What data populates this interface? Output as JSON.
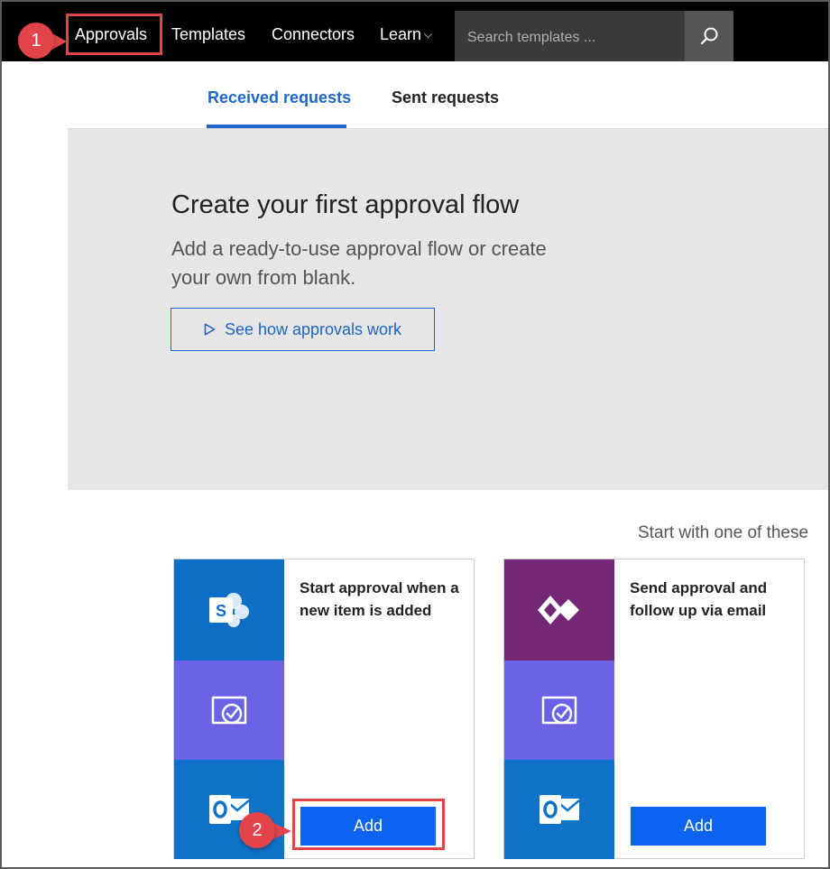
{
  "nav": {
    "items": [
      "Approvals",
      "Templates",
      "Connectors",
      "Learn"
    ],
    "learn_chevron": "⌵",
    "search": {
      "placeholder": "Search templates ...",
      "icon": "search-icon"
    }
  },
  "callouts": {
    "step1": "1",
    "step2": "2"
  },
  "tabs": [
    {
      "label": "Received requests",
      "active": true
    },
    {
      "label": "Sent requests",
      "active": false
    }
  ],
  "hero": {
    "title": "Create your first approval flow",
    "subtitle": "Add a ready-to-use approval flow or create your own from blank.",
    "cta_label": "See how approvals work",
    "cta_icon": "play-icon"
  },
  "templates_intro": "Start with one of these",
  "templates": [
    {
      "title": "Start approval when a new item is added",
      "icons": [
        "sharepoint-icon",
        "approvals-icon",
        "outlook-icon"
      ],
      "add_label": "Add"
    },
    {
      "title": "Send approval and follow up via email",
      "icons": [
        "powerapps-icon",
        "approvals-icon",
        "outlook-icon"
      ],
      "add_label": "Add"
    }
  ],
  "colors": {
    "accent": "#1e66c7",
    "add_button": "#0b63f0",
    "callout": "#e2444a",
    "sharepoint": "#0f6fc6",
    "powerapps": "#742774",
    "approvals": "#6a63e6",
    "outlook": "#0d72c8"
  }
}
